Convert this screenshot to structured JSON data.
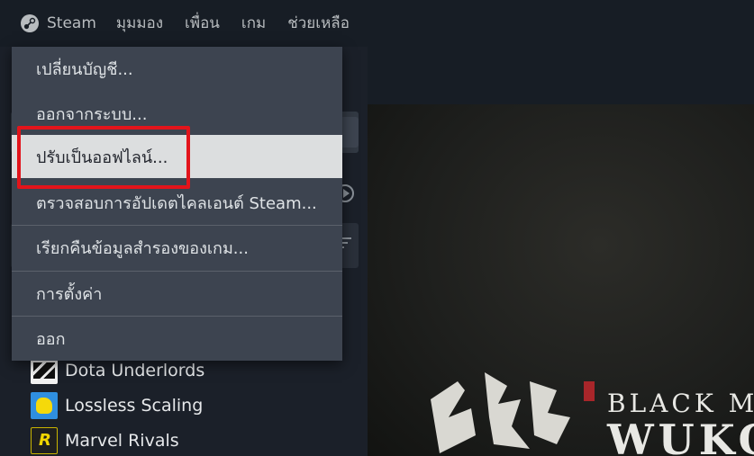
{
  "menubar": {
    "steam_label": "Steam",
    "view_label": "มุมมอง",
    "friends_label": "เพื่อน",
    "games_label": "เกม",
    "help_label": "ช่วยเหลือ"
  },
  "dropdown": {
    "items": [
      {
        "label": "เปลี่ยนบัญชี..."
      },
      {
        "label": "ออกจากระบบ..."
      },
      {
        "label": "ปรับเป็นออฟไลน์..."
      },
      {
        "label": "ตรวจสอบการอัปเดตไคลเอนต์ Steam..."
      },
      {
        "label": "เรียกคืนข้อมูลสำรองของเกม..."
      },
      {
        "label": "การตั้งค่า"
      },
      {
        "label": "ออก"
      }
    ],
    "highlighted_index": 2
  },
  "library": {
    "games": [
      {
        "name": "Dota Underlords",
        "icon": "dota-underlords-icon"
      },
      {
        "name": "Lossless Scaling",
        "icon": "lossless-scaling-icon"
      },
      {
        "name": "Marvel Rivals",
        "icon": "marvel-rivals-icon"
      }
    ]
  },
  "hero": {
    "title_line1": "BLACK M",
    "title_line2": "WUKO"
  },
  "colors": {
    "highlight_box": "#e3141b",
    "menu_bg": "#3d4450",
    "menu_hover": "#dcdedf"
  }
}
